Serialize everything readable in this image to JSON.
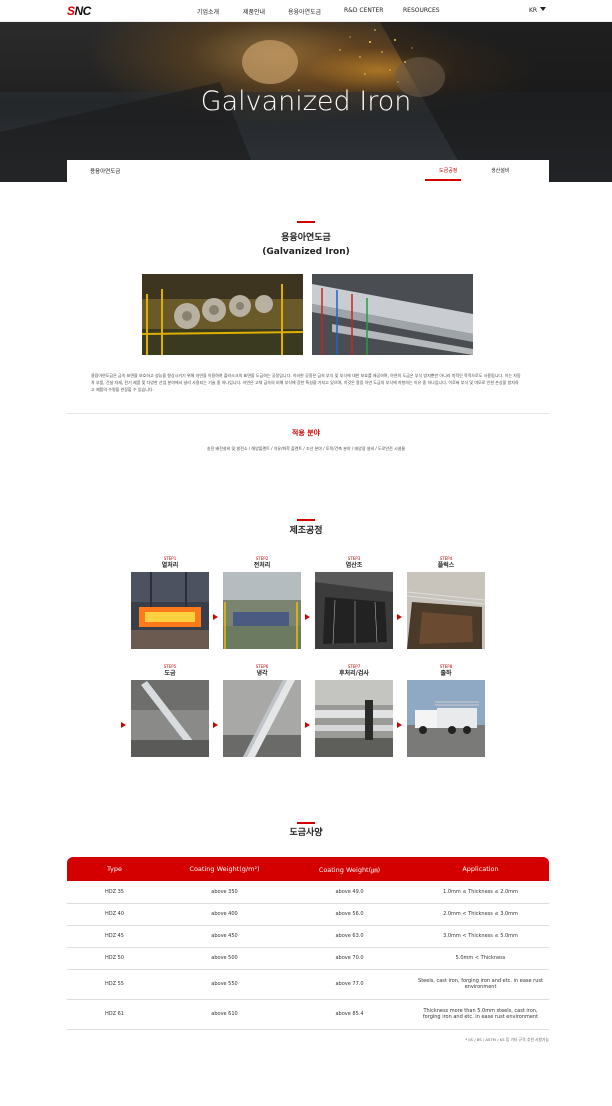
{
  "nav": {
    "logo": "SNC",
    "items": [
      "기업소개",
      "제품안내",
      "용융아연도금",
      "R&D CENTER",
      "RESOURCES"
    ],
    "lang": "KR"
  },
  "hero": {
    "title": "Galvanized Iron"
  },
  "subnav": {
    "title": "용융아연도금",
    "tabs": [
      "도금공정",
      "생산설비"
    ],
    "active_tab": "도금공정"
  },
  "intro": {
    "title_ko": "용융아연도금",
    "title_en": "(Galvanized Iron)",
    "description": "용융아연도금은 금속 표면을 보호하고 성능을 향상시키기 위해 아연을 이용하여 플라스크의 표면을 도금하는 공정입니다. 이러한 공정은 금속 부식 및 부식에 대한 보호를 제공하며, 아연의 도금은 부식 방지뿐만 아니라 미적인 목적으로도 사용됩니다. 이는 자동차 부품, 건설 자재, 전기 제품 및 다양한 산업 분야에서 널리 사용되는 기술 중 하나입니다. 아연은 고체 금속의 비해 부식에 강한 특성을 가지고 있으며, 이것은 용융 아연 도금의 부식에 저항하는 이유 중 하나입니다. 이로써 부식 및 마모로 인한 손상을 방지하고 제품의 수명을 연장할 수 있습니다."
  },
  "application": {
    "title": "적용 분야",
    "text": "송전 배전설비 및 발전소 / 해양플랜트 / 석유/화학 플랜트 / 조선 분야 / 토목/건축 분야 / 태양광 설비 / 도로안전 시설물"
  },
  "process": {
    "title": "제조공정",
    "steps": [
      {
        "step": "STEP1",
        "name": "열처리",
        "icon": "furnace-photo"
      },
      {
        "step": "STEP2",
        "name": "전처리",
        "icon": "pretreatment-photo"
      },
      {
        "step": "STEP3",
        "name": "염산조",
        "icon": "acid-tank-photo"
      },
      {
        "step": "STEP4",
        "name": "플럭스",
        "icon": "flux-tank-photo"
      },
      {
        "step": "STEP5",
        "name": "도금",
        "icon": "galvanizing-photo"
      },
      {
        "step": "STEP6",
        "name": "냉각",
        "icon": "cooling-photo"
      },
      {
        "step": "STEP7",
        "name": "후처리/검사",
        "icon": "inspection-photo"
      },
      {
        "step": "STEP8",
        "name": "출하",
        "icon": "shipping-photo"
      }
    ]
  },
  "spec": {
    "title": "도금사양",
    "headers": [
      "Type",
      "Coating Weight(g/m²)",
      "Coating Weight(㎛)",
      "Application"
    ],
    "rows": [
      [
        "HDZ 35",
        "above 350",
        "above 49.0",
        "1.0mm ≤ Thickness ≤ 2.0mm"
      ],
      [
        "HDZ 40",
        "above 400",
        "above 56.0",
        "2.0mm < Thickness ≤ 3.0mm"
      ],
      [
        "HDZ 45",
        "above 450",
        "above 63.0",
        "3.0mm < Thickness ≤ 5.0mm"
      ],
      [
        "HDZ 50",
        "above 500",
        "above 70.0",
        "5.0mm < Thickness"
      ],
      [
        "HDZ 55",
        "above 550",
        "above 77.0",
        "Steels, cast iron, forging iron and etc. in ease rust environment"
      ],
      [
        "HDZ 61",
        "above 610",
        "above 85.4",
        "Thickness more than 5.0mm steels, cast iron, forging iron and etc. in ease rust environment"
      ]
    ],
    "note": "* JIS / BS / ASTM / KS 등 기타 규격 추천 사항가능"
  },
  "colors": {
    "accent": "#d40000"
  }
}
